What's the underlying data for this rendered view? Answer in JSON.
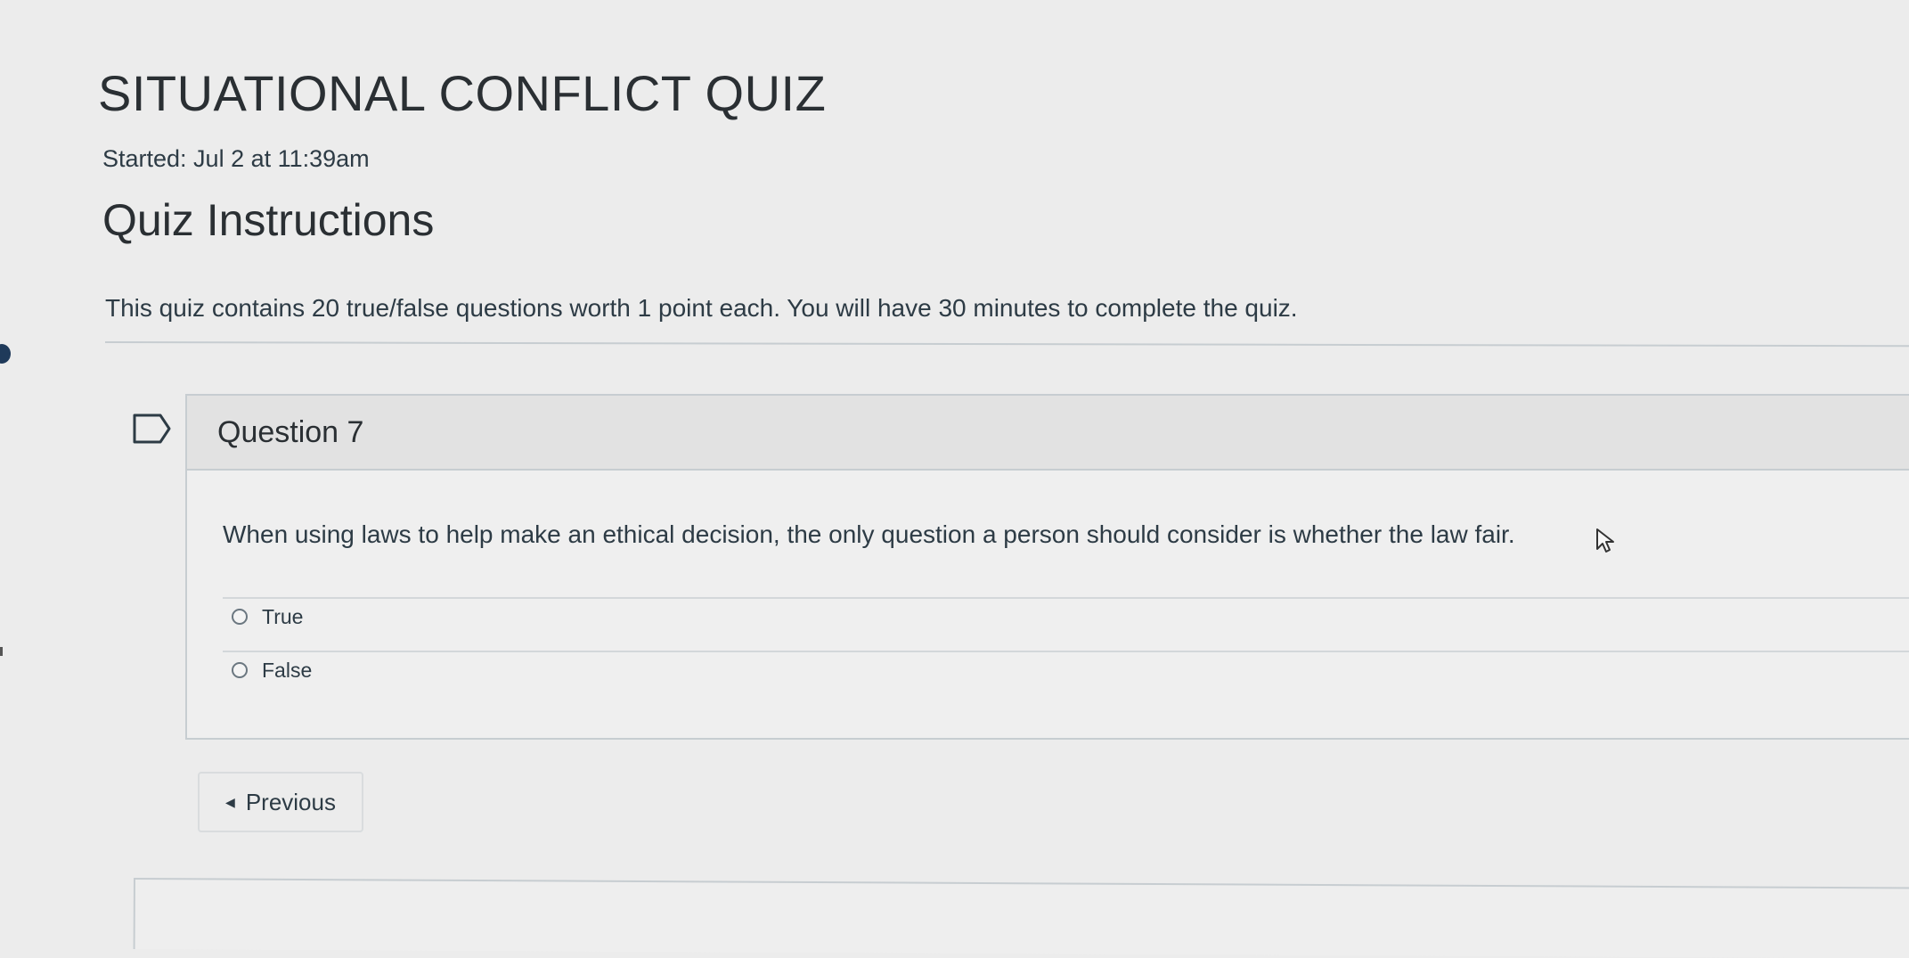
{
  "quiz": {
    "title": "SITUATIONAL CONFLICT QUIZ",
    "started": "Started: Jul 2 at 11:39am",
    "instructions_heading": "Quiz Instructions",
    "instructions_text": "This quiz contains 20 true/false questions worth 1 point each. You will have 30 minutes to complete the quiz."
  },
  "question": {
    "number_label": "Question 7",
    "text": "When using laws to help make an ethical decision, the only question a person should consider is whether the law fair.",
    "answers": [
      {
        "label": "True"
      },
      {
        "label": "False"
      }
    ]
  },
  "navigation": {
    "previous_label": "Previous",
    "previous_icon": "caret-left-icon"
  },
  "icons": {
    "flag": "flag-question-icon",
    "cursor": "mouse-cursor-icon"
  }
}
